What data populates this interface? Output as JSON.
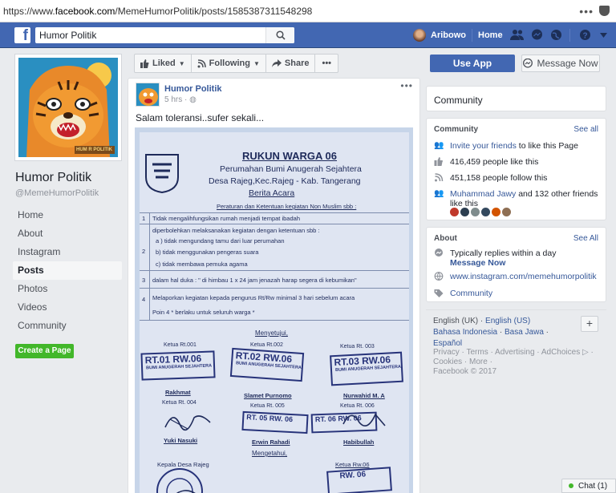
{
  "browser": {
    "url_prefix": "https://www.",
    "url_domain": "facebook.com",
    "url_path": "/MemeHumorPolitik/posts/1585387311548298",
    "menu_dots": "•••"
  },
  "topbar": {
    "logo": "f",
    "search_value": "Humor Politik",
    "user_name": "Aribowo",
    "home_label": "Home",
    "brand_color": "#4267b2"
  },
  "page": {
    "name": "Humor Politik",
    "handle": "@MemeHumorPolitik",
    "cover_caption": "HUM R POLITIK"
  },
  "nav": {
    "items": [
      "Home",
      "About",
      "Instagram",
      "Posts",
      "Photos",
      "Videos",
      "Community"
    ],
    "active": "Posts",
    "create_page": "Create a Page"
  },
  "actions": {
    "liked": "Liked",
    "following": "Following",
    "share": "Share",
    "more": "•••",
    "use_app": "Use App",
    "message_now": "Message Now"
  },
  "post": {
    "author": "Humor Politik",
    "time": "5 hrs ·",
    "more": "•••",
    "text": "Salam toleransi..sufer sekali...",
    "doc": {
      "title": "RUKUN WARGA 06",
      "line1": "Perumahan Bumi Anugerah Sejahtera",
      "line2": "Desa Rajeg,Kec.Rajeg - Kab. Tangerang",
      "line3": "Berita Acara",
      "subtitle": "Peraturan dan Ketentuan kegiatan Non Muslim sbb :",
      "rules": [
        "Tidak mengalihfungsikan rumah menjadi tempat ibadah",
        "diperbolehkan melaksanakan kegiatan dengan ketentuan sbb :",
        "a )   tidak mengundang tamu dari luar perumahan",
        "b)    tidak menggunakan pengeras suara",
        "c)    tidak membawa pemuka agama",
        "dalam hal duka :  \" di himbau 1 x 24 jam jenazah harap segera di kebumikan\"",
        "Melaporkan kegiatan kepada pengurus Rt/Rw minimal 3 hari sebelum acara",
        "Poin 4     * berlaku untuk seluruh warga *"
      ],
      "nums": [
        "1",
        "2",
        "3",
        "4"
      ],
      "menyetujui": "Menyetujui,",
      "ketua": [
        "Ketua Rt.001",
        "Ketua Rt.002",
        "Ketua Rt. 003",
        "Ketua Rt. 004",
        "Ketua Rt. 005",
        "Ketua Rt. 006"
      ],
      "stamps": [
        "RT.01 RW.06",
        "RT.02 RW.06",
        "RT.03 RW.06",
        "RT. 05 RW. 06",
        "RT. 06 RW. 06"
      ],
      "stamp_sub": "BUMI ANUGERAH SEJAHTERA",
      "names": [
        "Rakhmat",
        "Slamet Purnomo",
        "Nurwahid M. A",
        "Yuki Nasuki",
        "Erwin Rahadi",
        "Habibullah"
      ],
      "mengetahui": "Mengetahui,",
      "kepala": "Kepala Desa Rajeg",
      "ketua_rw": "Ketua Rw.06",
      "bottom_stamp": "RW. 06"
    }
  },
  "community_header": "Community",
  "community": {
    "title": "Community",
    "see_all": "See all",
    "invite_link": "Invite your friends",
    "invite_rest": " to like this Page",
    "likes": "416,459 people like this",
    "follows": "451,158 people follow this",
    "friend_name": "Muhammad Jawy",
    "friend_rest": " and 132 other friends like this"
  },
  "about": {
    "title": "About",
    "see_all": "See All",
    "replies": "Typically replies within a day",
    "message_now": "Message Now",
    "website": "www.instagram.com/memehumorpolitik",
    "category": "Community"
  },
  "languages": {
    "current": "English (UK)",
    "sep": " · ",
    "others": [
      "English (US)",
      "Bahasa Indonesia",
      "Basa Jawa",
      "Español"
    ],
    "add": "+"
  },
  "footer": {
    "line1": "Privacy · Terms · Advertising · AdChoices",
    "line2": "Cookies · More ·",
    "line3": "Facebook © 2017"
  },
  "chat": {
    "label": "Chat (1)"
  }
}
